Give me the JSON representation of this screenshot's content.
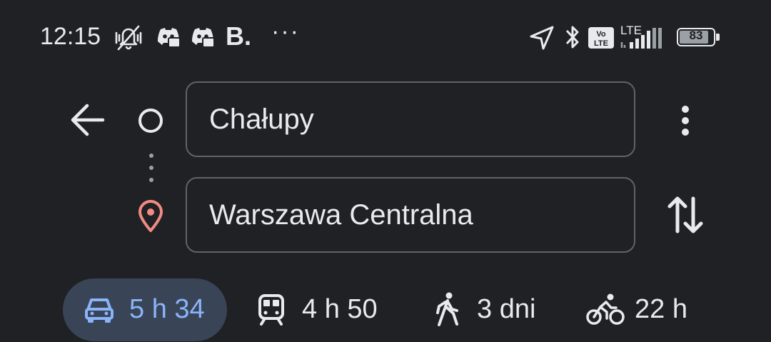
{
  "status_bar": {
    "time": "12:15",
    "app_letter": "B.",
    "overflow_dots": "···",
    "network_label": "LTE",
    "battery_percent": "83",
    "icons": [
      "mute-icon",
      "discord-icon",
      "discord-icon",
      "location-arrow-icon",
      "bluetooth-icon",
      "volte-icon",
      "signal-icon",
      "battery-icon"
    ]
  },
  "directions": {
    "origin": {
      "value": "Chałupy",
      "icon": "origin-circle-icon"
    },
    "destination": {
      "value": "Warszawa Centralna",
      "icon": "destination-pin-icon"
    },
    "back_icon": "back-arrow-icon",
    "more_icon": "more-vert-icon",
    "swap_icon": "swap-icon"
  },
  "travel_modes": [
    {
      "mode": "car",
      "icon": "car-icon",
      "duration": "5 h 34",
      "selected": true
    },
    {
      "mode": "transit",
      "icon": "train-icon",
      "duration": "4 h 50",
      "selected": false
    },
    {
      "mode": "walk",
      "icon": "walk-icon",
      "duration": "3 dni",
      "selected": false
    },
    {
      "mode": "bike",
      "icon": "bike-icon",
      "duration": "22 h",
      "selected": false
    }
  ],
  "colors": {
    "background": "#202124",
    "active_chip": "#394457",
    "active_text": "#8ab4f8",
    "destination_pin": "#f28b82",
    "field_border": "#5f6368"
  }
}
